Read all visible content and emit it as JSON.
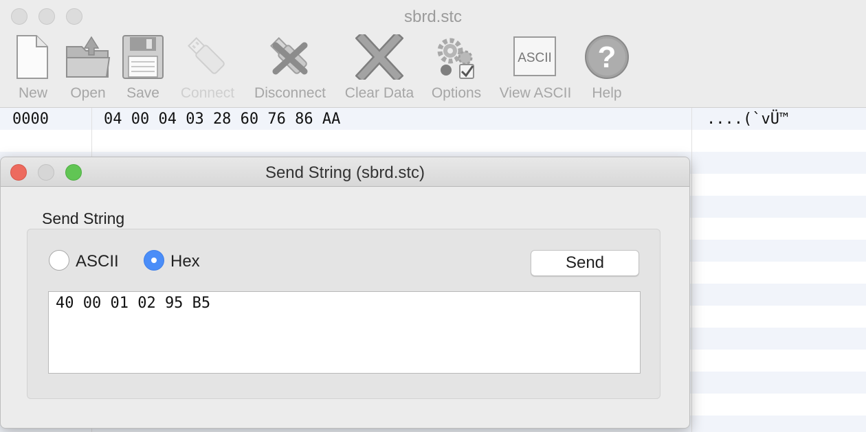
{
  "window": {
    "title": "sbrd.stc"
  },
  "toolbar": {
    "items": [
      {
        "label": "New",
        "icon": "document-icon",
        "enabled": true
      },
      {
        "label": "Open",
        "icon": "folder-open-icon",
        "enabled": true
      },
      {
        "label": "Save",
        "icon": "floppy-disk-icon",
        "enabled": true
      },
      {
        "label": "Connect",
        "icon": "usb-plug-icon",
        "enabled": false
      },
      {
        "label": "Disconnect",
        "icon": "usb-disconnect-icon",
        "enabled": true
      },
      {
        "label": "Clear Data",
        "icon": "x-mark-icon",
        "enabled": true
      },
      {
        "label": "Options",
        "icon": "gears-icon",
        "enabled": true
      },
      {
        "label": "View ASCII",
        "icon": "ascii-icon",
        "enabled": true
      },
      {
        "label": "Help",
        "icon": "question-icon",
        "enabled": true
      }
    ],
    "ascii_icon_text": "ASCII",
    "help_icon_text": "?"
  },
  "hex_view": {
    "rows": [
      {
        "offset": "0000",
        "hex": "04 00 04 03 28 60 76 86 AA",
        "ascii": "....(`vÜ™"
      }
    ]
  },
  "dialog": {
    "title": "Send String (sbrd.stc)",
    "group_label": "Send String",
    "mode_ascii_label": "ASCII",
    "mode_hex_label": "Hex",
    "selected_mode": "Hex",
    "send_label": "Send",
    "input_value": "40 00 01 02 95 B5"
  },
  "colors": {
    "close": "#ed6a5e",
    "minimize": "#d6d6d6",
    "zoom": "#61c554",
    "radio_selected": "#4a8df8",
    "row_stripe": "#f1f4fa"
  }
}
